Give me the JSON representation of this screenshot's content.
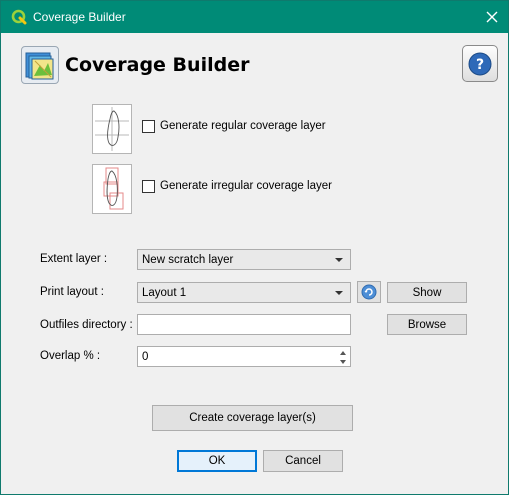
{
  "window": {
    "title": "Coverage Builder"
  },
  "header": {
    "title": "Coverage Builder",
    "help_icon": "help-icon"
  },
  "options": {
    "regular": {
      "label": "Generate regular coverage layer",
      "checked": false
    },
    "irregular": {
      "label": "Generate irregular coverage layer",
      "checked": false
    }
  },
  "form": {
    "extent_layer": {
      "label": "Extent layer :",
      "value": "New scratch layer"
    },
    "print_layout": {
      "label": "Print layout :",
      "value": "Layout 1",
      "show_label": "Show"
    },
    "outfiles": {
      "label": "Outfiles directory :",
      "value": "",
      "browse_label": "Browse"
    },
    "overlap": {
      "label": "Overlap % :",
      "value": "0"
    }
  },
  "actions": {
    "create_label": "Create coverage layer(s)",
    "ok_label": "OK",
    "cancel_label": "Cancel"
  },
  "colors": {
    "titlebar": "#008b77",
    "accent": "#0078d7"
  }
}
